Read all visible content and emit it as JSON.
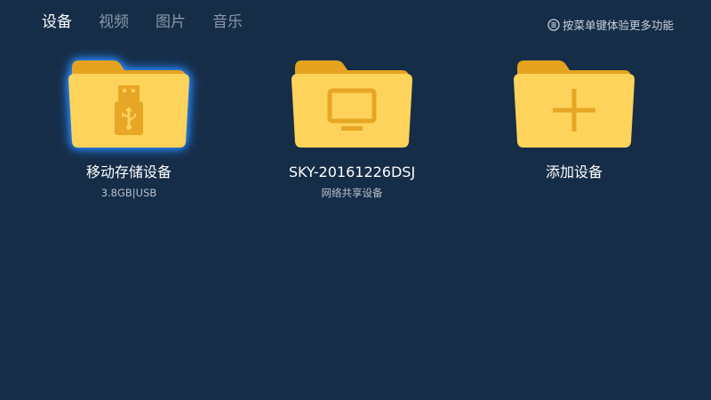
{
  "tabs": [
    {
      "label": "设备",
      "active": true
    },
    {
      "label": "视频",
      "active": false
    },
    {
      "label": "图片",
      "active": false
    },
    {
      "label": "音乐",
      "active": false
    }
  ],
  "hint": {
    "icon": "menu-icon",
    "text": "按菜单键体验更多功能"
  },
  "colors": {
    "background": "#162d48",
    "folder_front": "#fdd35b",
    "folder_back": "#e6a31f",
    "folder_glyph": "#e7a625",
    "focus_glow": "#2a8cff"
  },
  "devices": [
    {
      "name": "移动存储设备",
      "sub": "3.8GB|USB",
      "icon": "usb-icon",
      "focused": true
    },
    {
      "name": "SKY-20161226DSJ",
      "sub": "网络共享设备",
      "icon": "monitor-icon",
      "focused": false
    },
    {
      "name": "添加设备",
      "sub": "",
      "icon": "plus-icon",
      "focused": false
    }
  ]
}
